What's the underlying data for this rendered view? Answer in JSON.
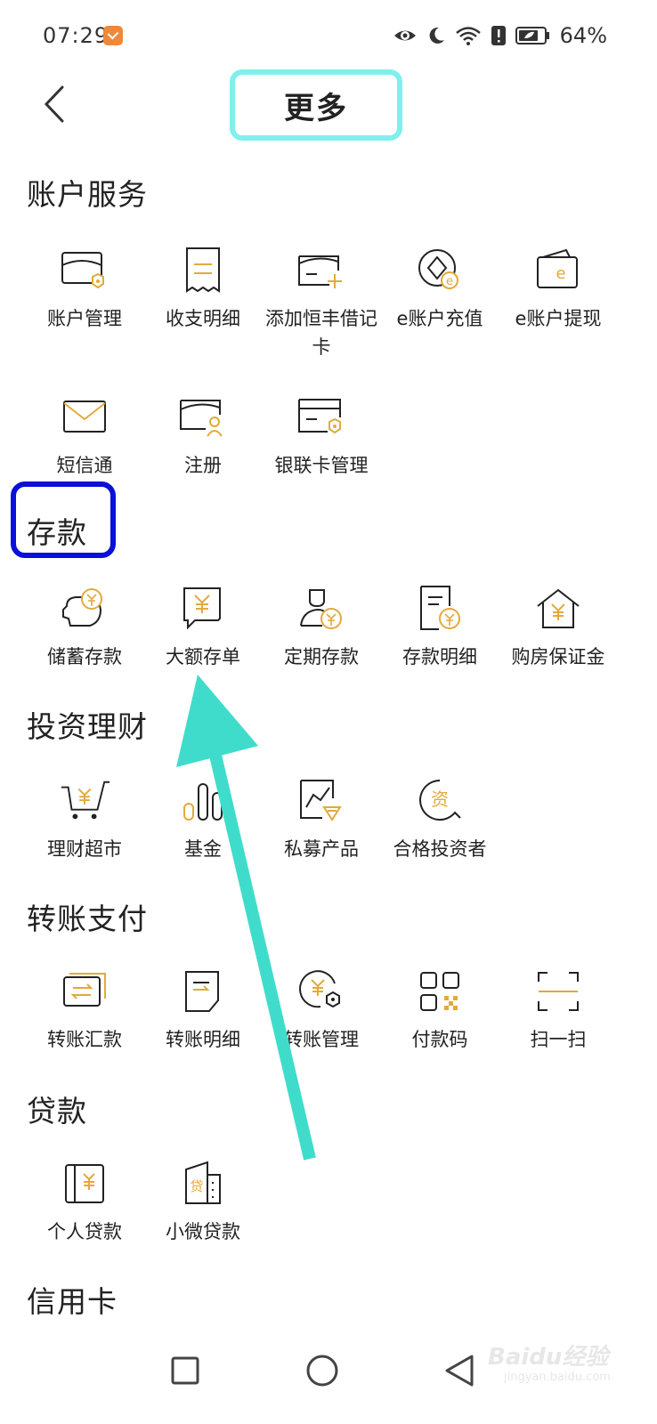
{
  "status_bar": {
    "time": "07:29",
    "battery": "64%",
    "icons": [
      "app-badge-icon",
      "eye-icon",
      "moon-icon",
      "wifi-icon",
      "alert-icon",
      "battery-icon"
    ]
  },
  "header": {
    "back_icon": "chevron-left-icon",
    "title": "更多"
  },
  "sections": {
    "account": {
      "title": "账户服务",
      "items": [
        {
          "label": "账户管理",
          "icon": "card-shield-icon"
        },
        {
          "label": "收支明细",
          "icon": "receipt-icon"
        },
        {
          "label": "添加恒丰借记卡",
          "icon": "card-add-icon"
        },
        {
          "label": "e账户充值",
          "icon": "e-coin-icon"
        },
        {
          "label": "e账户提现",
          "icon": "e-wallet-icon"
        },
        {
          "label": "短信通",
          "icon": "envelope-icon"
        },
        {
          "label": "注册",
          "icon": "card-user-icon"
        },
        {
          "label": "银联卡管理",
          "icon": "unionpay-card-icon"
        }
      ]
    },
    "deposit": {
      "title": "存款",
      "items": [
        {
          "label": "储蓄存款",
          "icon": "piggy-bank-icon"
        },
        {
          "label": "大额存单",
          "icon": "certificate-yuan-icon"
        },
        {
          "label": "定期存款",
          "icon": "person-yuan-icon"
        },
        {
          "label": "存款明细",
          "icon": "doc-yuan-icon"
        },
        {
          "label": "购房保证金",
          "icon": "house-yuan-icon"
        }
      ]
    },
    "invest": {
      "title": "投资理财",
      "items": [
        {
          "label": "理财超市",
          "icon": "cart-yuan-icon"
        },
        {
          "label": "基金",
          "icon": "bar-chart-icon"
        },
        {
          "label": "私募产品",
          "icon": "trend-chart-icon"
        },
        {
          "label": "合格投资者",
          "icon": "investor-badge-icon"
        }
      ]
    },
    "transfer": {
      "title": "转账支付",
      "items": [
        {
          "label": "转账汇款",
          "icon": "transfer-card-icon"
        },
        {
          "label": "转账明细",
          "icon": "transfer-doc-icon"
        },
        {
          "label": "转账管理",
          "icon": "transfer-settings-icon"
        },
        {
          "label": "付款码",
          "icon": "qr-code-icon"
        },
        {
          "label": "扫一扫",
          "icon": "scan-icon"
        }
      ]
    },
    "loan": {
      "title": "贷款",
      "items": [
        {
          "label": "个人贷款",
          "icon": "loan-book-icon"
        },
        {
          "label": "小微贷款",
          "icon": "business-loan-icon"
        }
      ]
    },
    "credit": {
      "title": "信用卡"
    }
  },
  "nav_bar": {
    "icons": [
      "recents-square-icon",
      "home-circle-icon",
      "back-triangle-icon"
    ]
  },
  "watermark": {
    "text": "Baidu经验",
    "sub": "jingyan.baidu.com"
  },
  "colors": {
    "gold": "#e3a93a",
    "ink": "#222222",
    "title_highlight": "#7ff0ee",
    "section_highlight": "#0a10d8",
    "arrow": "#40dccb"
  }
}
